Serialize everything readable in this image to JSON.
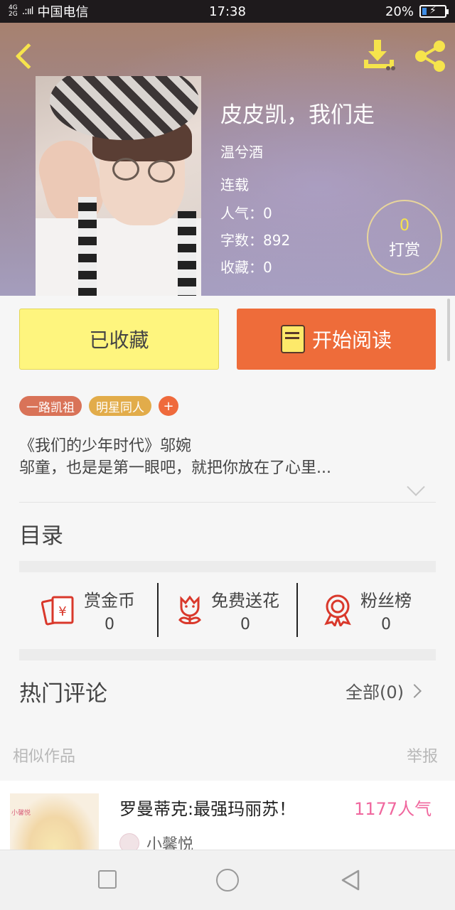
{
  "status_bar": {
    "net_top": "4G",
    "net_bottom": "2G",
    "signal": ".:ııl",
    "carrier": "中国电信",
    "time": "17:38",
    "battery": "20%"
  },
  "book": {
    "title": "皮皮凯，我们走",
    "author": "温兮酒",
    "status": "连载",
    "popularity_label": "人气：",
    "popularity_value": "0",
    "words_label": "字数：",
    "words_value": "892",
    "favorites_label": "收藏：",
    "favorites_value": "0"
  },
  "reward": {
    "count": "0",
    "label": "打赏"
  },
  "buttons": {
    "favorited": "已收藏",
    "start_reading": "开始阅读"
  },
  "tags": [
    "一路凯祖",
    "明星同人"
  ],
  "tag_add": "+",
  "description": {
    "line1": "《我们的少年时代》邬婉",
    "line2": "邬童，也是是第一眼吧，就把你放在了心里..."
  },
  "toc_label": "目录",
  "actions": [
    {
      "label": "赏金币",
      "value": "0",
      "icon": "red-envelope-yen-icon"
    },
    {
      "label": "免费送花",
      "value": "0",
      "icon": "flower-icon"
    },
    {
      "label": "粉丝榜",
      "value": "0",
      "icon": "award-ribbon-icon"
    }
  ],
  "comments": {
    "title": "热门评论",
    "all_label": "全部(0)"
  },
  "similar": {
    "title": "相似作品",
    "report": "举报"
  },
  "recommendation": {
    "brand": "小馨悦",
    "title": "罗曼蒂克:最强玛丽苏！",
    "popularity": "1177人气",
    "author": "小馨悦"
  },
  "colors": {
    "accent_yellow": "#f6e44c",
    "fav_button": "#fef57e",
    "read_button": "#ee6c3a",
    "icon_red": "#d9382b",
    "popularity_pink": "#f0679e"
  }
}
